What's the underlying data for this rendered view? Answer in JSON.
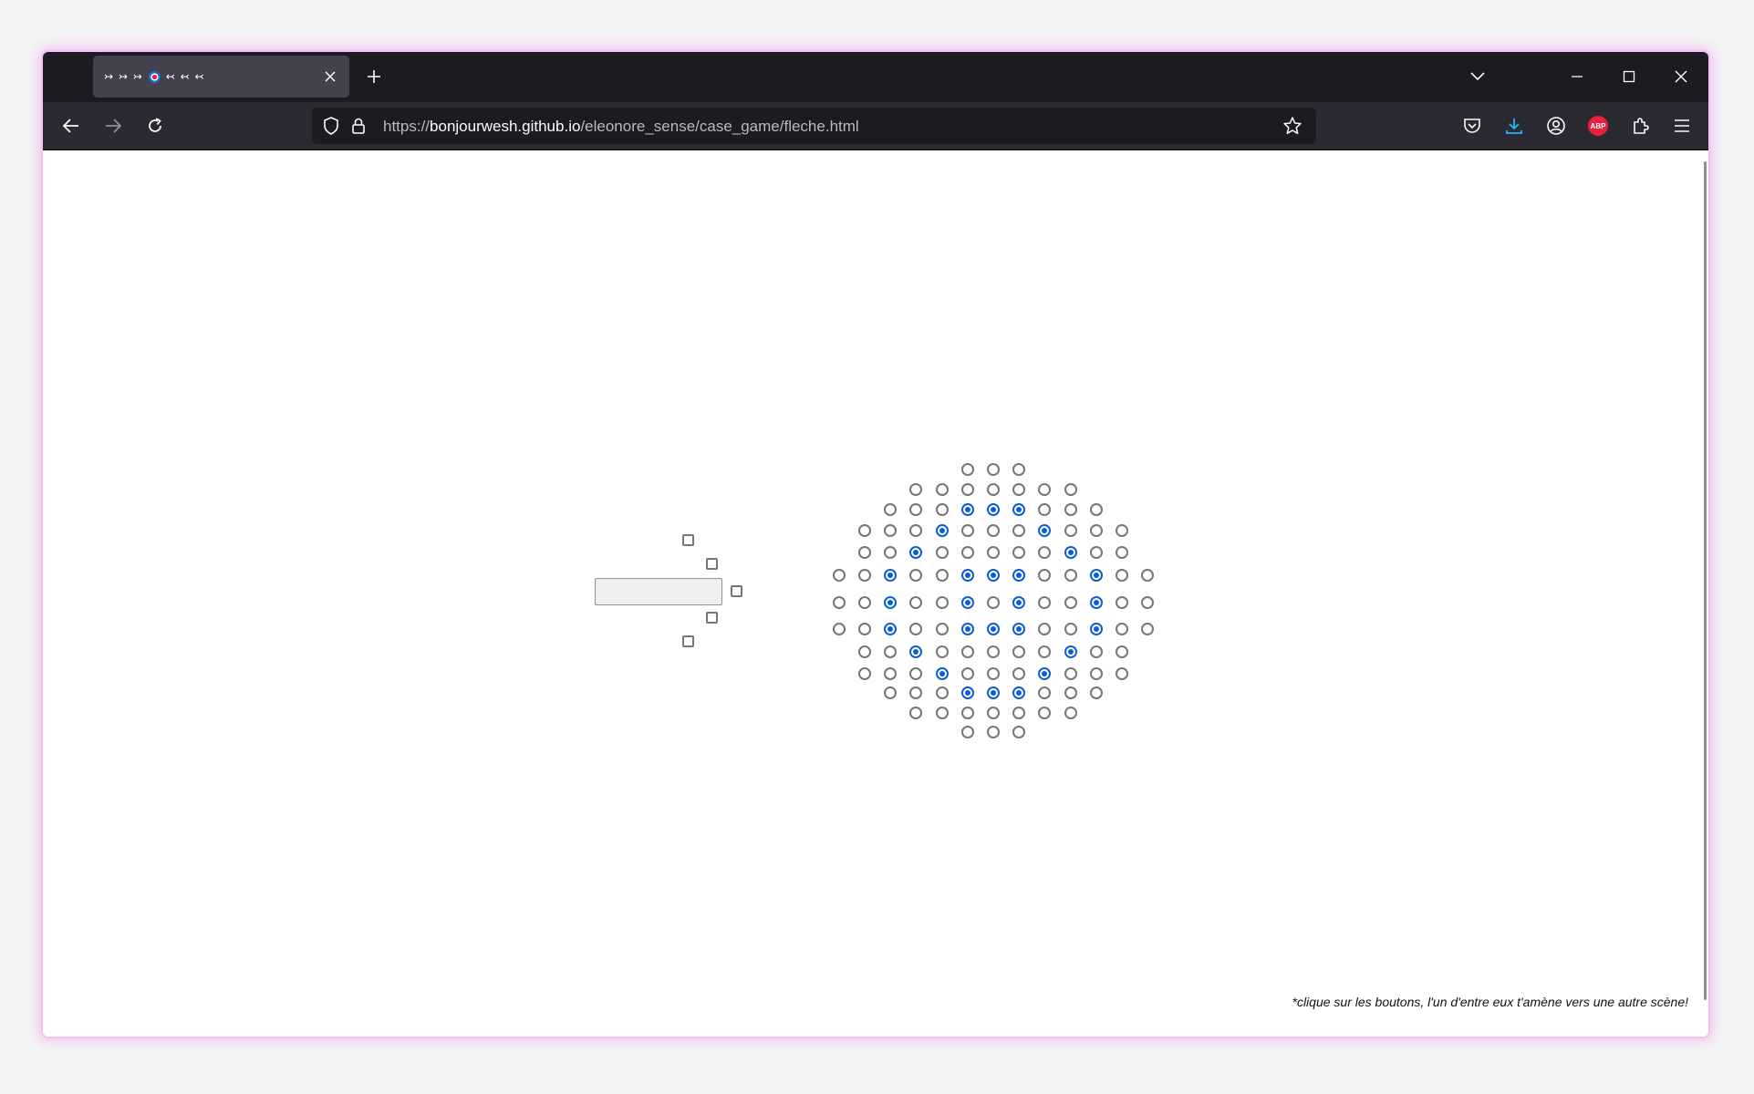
{
  "browser": {
    "tab": {
      "title_left": "↣ ↣ ↣",
      "title_right": "↢ ↢ ↢",
      "icon": "dartboard-icon"
    },
    "url": {
      "scheme": "https://",
      "host": "bonjourwesh.github.io",
      "path": "/eleonore_sense/case_game/fleche.html"
    },
    "toolbar_icons": [
      "pocket-icon",
      "download-icon",
      "account-icon",
      "adblock-icon",
      "extensions-icon",
      "menu-icon"
    ],
    "abp_label": "ABP",
    "download_color": "#20b6ff"
  },
  "page": {
    "text_input": {
      "value": ""
    },
    "checkboxes_count": 5,
    "radio_rows": [
      [
        0,
        0,
        0
      ],
      [
        0,
        0,
        0,
        0,
        0,
        0,
        0
      ],
      [
        0,
        0,
        0,
        1,
        1,
        1,
        0,
        0,
        0
      ],
      [
        0,
        0,
        0,
        1,
        0,
        0,
        0,
        1,
        0,
        0,
        0
      ],
      [
        0,
        0,
        1,
        0,
        0,
        0,
        0,
        0,
        1,
        0,
        0
      ],
      [
        0,
        0,
        1,
        0,
        0,
        1,
        1,
        1,
        0,
        0,
        1,
        0,
        0
      ],
      [
        0,
        0,
        1,
        0,
        0,
        1,
        0,
        1,
        0,
        0,
        1,
        0,
        0
      ],
      [
        0,
        0,
        1,
        0,
        0,
        1,
        1,
        1,
        0,
        0,
        1,
        0,
        0
      ],
      [
        0,
        0,
        1,
        0,
        0,
        0,
        0,
        0,
        1,
        0,
        0
      ],
      [
        0,
        0,
        0,
        1,
        0,
        0,
        0,
        1,
        0,
        0,
        0
      ],
      [
        0,
        0,
        0,
        1,
        1,
        1,
        0,
        0,
        0
      ],
      [
        0,
        0,
        0,
        0,
        0,
        0,
        0
      ],
      [
        0,
        0,
        0
      ]
    ],
    "note": "*clique sur les boutons, l'un d'entre eux t'amène vers une autre scène!",
    "accent_color": "#0b5ed7"
  }
}
